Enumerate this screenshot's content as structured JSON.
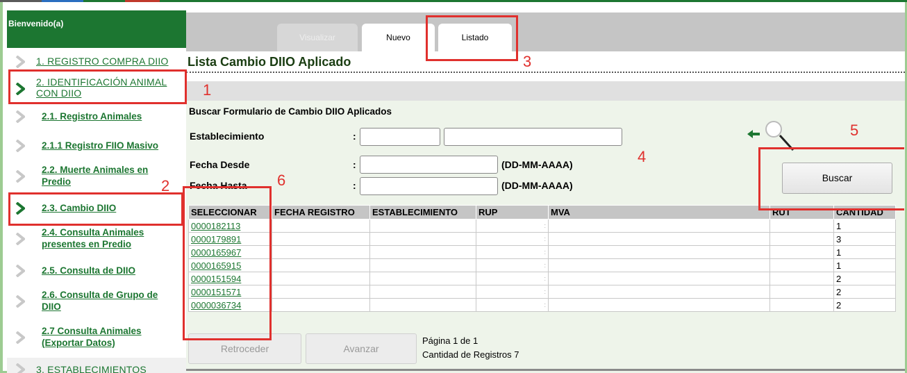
{
  "colors": {
    "brand_green": "#1c7631",
    "callout_red": "#e0302d",
    "panel_bg": "#eef4ea",
    "tab_bar": "#c5c5c5"
  },
  "sidebar": {
    "header": "Bienvenido(a)",
    "items": [
      {
        "label": "1. REGISTRO COMPRA DIIO",
        "icon": "chevron-right-icon"
      },
      {
        "label": "2. IDENTIFICACIÓN ANIMAL",
        "label2": "CON DIIO",
        "icon": "chevron-right-icon"
      },
      {
        "label": "2.1. Registro Animales",
        "icon": "chevron-right-icon"
      },
      {
        "label": "2.1.1 Registro FIIO Masivo",
        "icon": "chevron-right-icon"
      },
      {
        "label": "2.2. Muerte Animales en",
        "label2": "Predio",
        "icon": "chevron-right-icon"
      },
      {
        "label": "2.3. Cambio DIIO",
        "icon": "chevron-right-icon"
      },
      {
        "label": "2.4. Consulta Animales",
        "label2": "presentes en Predio",
        "icon": "chevron-right-icon"
      },
      {
        "label": "2.5. Consulta de DIIO",
        "icon": "chevron-right-icon"
      },
      {
        "label": "2.6. Consulta de Grupo de",
        "label2": "DIIO",
        "icon": "chevron-right-icon"
      },
      {
        "label": "2.7 Consulta Animales",
        "label2": "(Exportar Datos)",
        "icon": "chevron-right-icon"
      },
      {
        "label": "3. ESTABLECIMIENTOS",
        "icon": "chevron-right-icon"
      }
    ]
  },
  "tabs": {
    "visualizar": "Visualizar",
    "nuevo": "Nuevo",
    "listado": "Listado"
  },
  "page_title": "Lista Cambio DIIO Aplicado",
  "form": {
    "heading": "Buscar  Formulario de Cambio DIIO Aplicados",
    "establecimiento_label": "Establecimiento",
    "fecha_desde_label": "Fecha Desde",
    "fecha_hasta_label": "Fecha Hasta",
    "colon": ":",
    "date_format": "(DD-MM-AAAA)",
    "establecimiento_code": "",
    "establecimiento_name": "",
    "fecha_desde": "",
    "fecha_hasta": "",
    "search_button": "Buscar"
  },
  "table": {
    "headers": [
      "SELECCIONAR",
      "FECHA REGISTRO",
      "ESTABLECIMIENTO",
      "RUP",
      "MVA",
      "RUT",
      "CANTIDAD"
    ],
    "rows": [
      {
        "id": "0000182113",
        "fecha": "",
        "establecimiento": "",
        "rup": ":",
        "mva": "",
        "rut": "",
        "cantidad": "1"
      },
      {
        "id": "0000179891",
        "fecha": "",
        "establecimiento": "",
        "rup": ":",
        "mva": "",
        "rut": "",
        "cantidad": "3"
      },
      {
        "id": "0000165967",
        "fecha": "",
        "establecimiento": "",
        "rup": ":",
        "mva": "",
        "rut": "",
        "cantidad": "1"
      },
      {
        "id": "0000165915",
        "fecha": "",
        "establecimiento": "",
        "rup": ":",
        "mva": "",
        "rut": "",
        "cantidad": "1"
      },
      {
        "id": "0000151594",
        "fecha": "",
        "establecimiento": "",
        "rup": ":",
        "mva": "",
        "rut": "",
        "cantidad": "2"
      },
      {
        "id": "0000151571",
        "fecha": "",
        "establecimiento": "",
        "rup": ":",
        "mva": "",
        "rut": "",
        "cantidad": "2"
      },
      {
        "id": "0000036734",
        "fecha": "",
        "establecimiento": "",
        "rup": ":",
        "mva": "",
        "rut": "",
        "cantidad": "2"
      }
    ]
  },
  "pager": {
    "prev_button": "Retroceder",
    "next_button": "Avanzar",
    "page_text": "Página 1 de 1",
    "count_text": "Cantidad de Registros 7"
  },
  "callouts": {
    "n1": "1",
    "n2": "2",
    "n3": "3",
    "n4": "4",
    "n5": "5",
    "n6": "6"
  }
}
